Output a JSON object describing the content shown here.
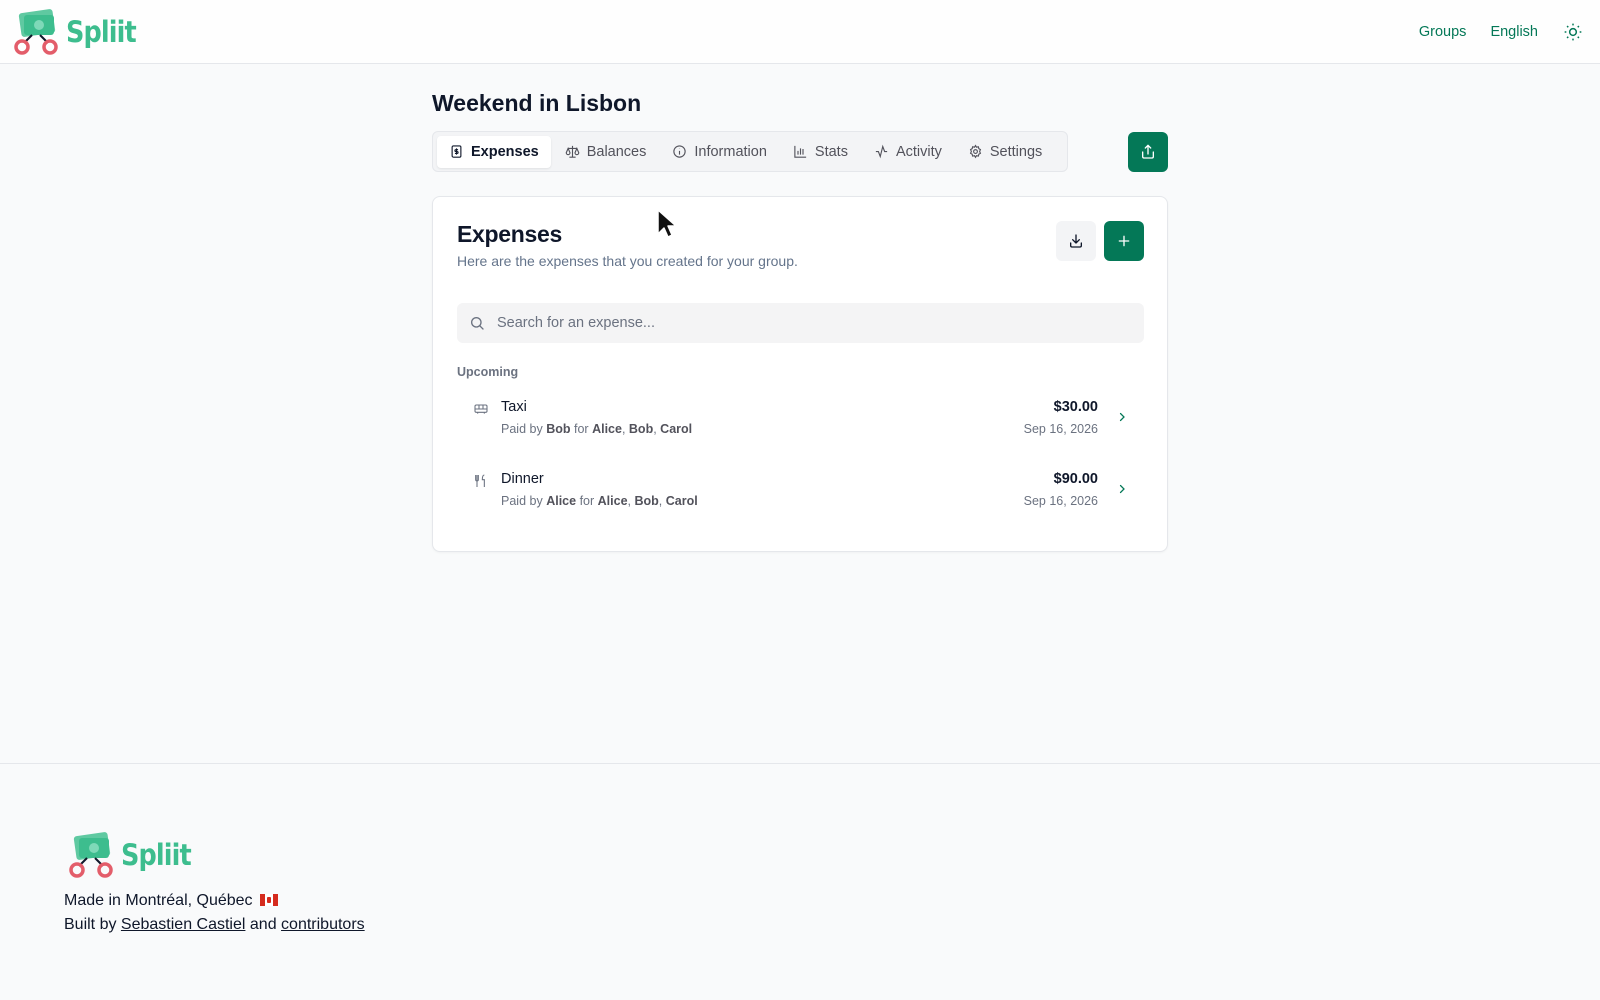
{
  "header": {
    "brand": "Spliit",
    "nav": {
      "groups": "Groups",
      "language": "English"
    },
    "icons": {
      "theme": "sun-icon",
      "logo": "spliit-logo-icon"
    }
  },
  "group": {
    "title": "Weekend in Lisbon"
  },
  "tabs": [
    {
      "label": "Expenses",
      "icon": "receipt-icon",
      "active": true
    },
    {
      "label": "Balances",
      "icon": "scale-icon",
      "active": false
    },
    {
      "label": "Information",
      "icon": "info-icon",
      "active": false
    },
    {
      "label": "Stats",
      "icon": "bar-chart-icon",
      "active": false
    },
    {
      "label": "Activity",
      "icon": "activity-icon",
      "active": false
    },
    {
      "label": "Settings",
      "icon": "gear-icon",
      "active": false
    }
  ],
  "expenses_card": {
    "title": "Expenses",
    "description": "Here are the expenses that you created for your group.",
    "search_placeholder": "Search for an expense...",
    "section_label": "Upcoming",
    "items": [
      {
        "title": "Taxi",
        "icon": "bus-icon",
        "paid_by_prefix": "Paid by",
        "payer": "Bob",
        "for_word": "for",
        "participants": [
          "Alice",
          "Bob",
          "Carol"
        ],
        "amount": "$30.00",
        "date": "Sep 16, 2026"
      },
      {
        "title": "Dinner",
        "icon": "utensils-icon",
        "paid_by_prefix": "Paid by",
        "payer": "Alice",
        "for_word": "for",
        "participants": [
          "Alice",
          "Bob",
          "Carol"
        ],
        "amount": "$90.00",
        "date": "Sep 16, 2026"
      }
    ]
  },
  "footer": {
    "brand": "Spliit",
    "made_in": "Made in Montréal, Québec",
    "built_by_prefix": "Built by",
    "author": "Sebastien Castiel",
    "and_word": "and",
    "contributors": "contributors"
  },
  "colors": {
    "accent": "#047857",
    "brand_green": "#3dbd8e",
    "logo_red": "#e35d6a"
  }
}
